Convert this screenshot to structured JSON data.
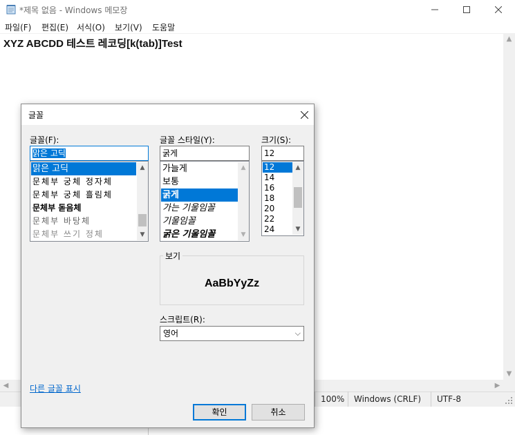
{
  "notepad": {
    "title": "*제목 없음 - Windows 메모장",
    "menu": [
      "파일(F)",
      "편집(E)",
      "서식(O)",
      "보기(V)",
      "도움말"
    ],
    "content": "XYZ ABCDD 테스트 레코딩[k(tab)]Test",
    "status": {
      "zoom": "100%",
      "line_ending": "Windows (CRLF)",
      "encoding": "UTF-8"
    }
  },
  "font_dialog": {
    "title": "글꼴",
    "font_label": "글꼴(F):",
    "font_value": "맑은 고딕",
    "font_list": [
      "맑은 고딕",
      "문체부 궁체 정자체",
      "문체부 궁체 흘림체",
      "문체부 돋음체",
      "문체부 바탕체",
      "문체부 쓰기 정체"
    ],
    "style_label": "글꼴 스타일(Y):",
    "style_value": "굵게",
    "style_list": [
      "가늘게",
      "보통",
      "굵게",
      "가는 기울임꼴",
      "기울임꼴",
      "굵은 기울임꼴"
    ],
    "size_label": "크기(S):",
    "size_value": "12",
    "size_list": [
      "12",
      "14",
      "16",
      "18",
      "20",
      "22",
      "24"
    ],
    "preview_label": "보기",
    "preview_text": "AaBbYyZz",
    "script_label": "스크립트(R):",
    "script_value": "영어",
    "more_fonts_link": "다른 글꼴 표시",
    "ok_label": "확인",
    "cancel_label": "취소"
  },
  "colors": {
    "accent": "#0078d7",
    "link": "#0066cc"
  },
  "icons": [
    "notepad-icon",
    "minimize-icon",
    "maximize-icon",
    "close-icon",
    "scroll-up-icon",
    "scroll-down-icon",
    "chevron-down-icon"
  ]
}
